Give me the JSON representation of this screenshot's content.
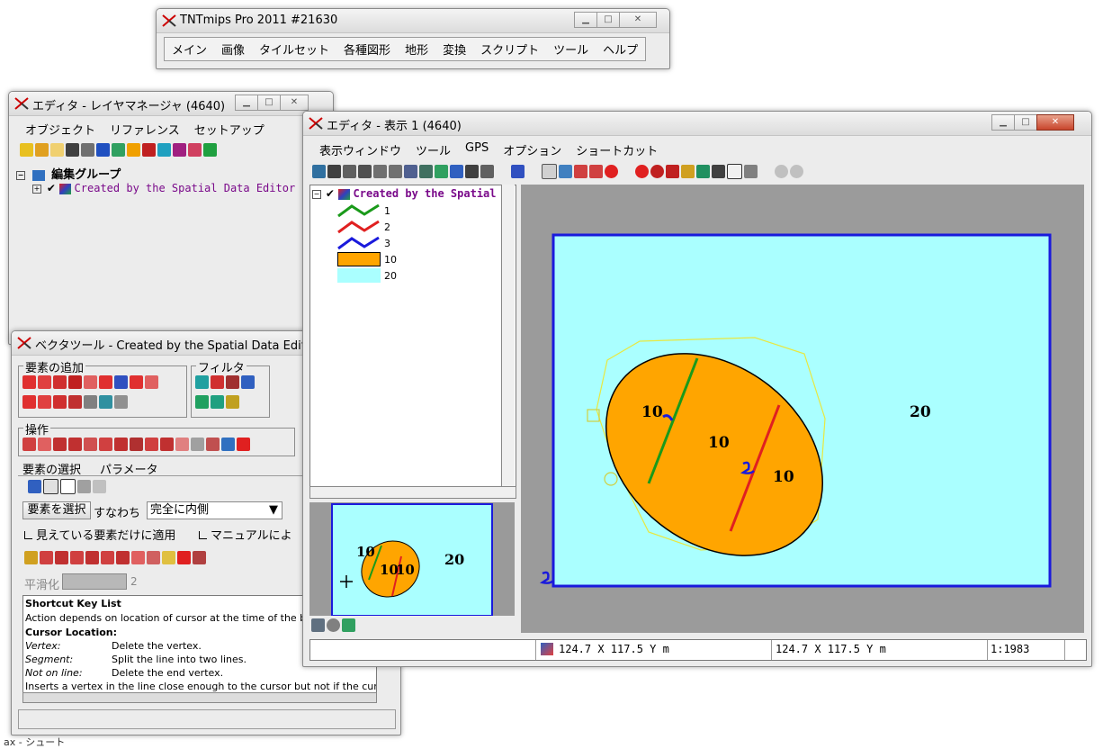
{
  "main_window": {
    "title": "TNTmips Pro 2011  #21630",
    "menu": [
      "メイン",
      "画像",
      "タイルセット",
      "各種図形",
      "地形",
      "変換",
      "スクリプト",
      "ツール",
      "ヘルプ"
    ]
  },
  "layer_manager": {
    "title": "エディタ - レイヤマネージャ (4640)",
    "menu": [
      "オブジェクト",
      "リファレンス",
      "セットアップ"
    ],
    "group_label": "編集グループ",
    "layer_label": "Created by the Spatial Data Editor"
  },
  "vector_tools": {
    "title": "ベクタツール - Created by the Spatial Data Edito...",
    "add_group": "要素の追加",
    "filter_group": "フィルタ",
    "ops_group": "操作",
    "select_tab": "要素の選択",
    "params_tab": "パラメータ",
    "select_button": "要素を選択",
    "namely_label": "すなわち",
    "select_mode": "完全に内側",
    "visible_only": "見えている要素だけに適用",
    "manual": "マニュアルによ",
    "smooth_label": "平滑化",
    "smooth_value": "2",
    "help": {
      "title": "Shortcut Key List",
      "line1": "Action depends on location of cursor at the time of the butt",
      "cursor_heading": "Cursor Location:",
      "rows": [
        {
          "key": "Vertex:",
          "desc": "Delete the vertex."
        },
        {
          "key": "Segment:",
          "desc": "Split the line into two lines."
        },
        {
          "key": "Not on line:",
          "desc": "Delete the end vertex."
        }
      ],
      "last_line": "Inserts a vertex in the line close enough to the cursor but not if the cursor"
    }
  },
  "display_window": {
    "title": "エディタ - 表示 1 (4640)",
    "menu": [
      "表示ウィンドウ",
      "ツール",
      "GPS",
      "オプション",
      "ショートカット"
    ],
    "layer_title": "Created by the Spatial D",
    "legend": [
      {
        "label": "1",
        "color": "#1a9a1a",
        "kind": "line"
      },
      {
        "label": "2",
        "color": "#e02020",
        "kind": "line"
      },
      {
        "label": "3",
        "color": "#1a1adc",
        "kind": "line"
      },
      {
        "label": "10",
        "color": "#ffa500",
        "kind": "fill"
      },
      {
        "label": "20",
        "color": "#aaffff",
        "kind": "fill"
      }
    ],
    "map_labels": {
      "poly_left": "10",
      "poly_center": "10",
      "poly_right": "10",
      "outer": "20"
    },
    "status": {
      "coords1": "124.7 X  117.5 Y m",
      "coords2": "124.7 X  117.5 Y m",
      "scale": "1:1983"
    }
  },
  "background_fragment": "ax - シュート"
}
